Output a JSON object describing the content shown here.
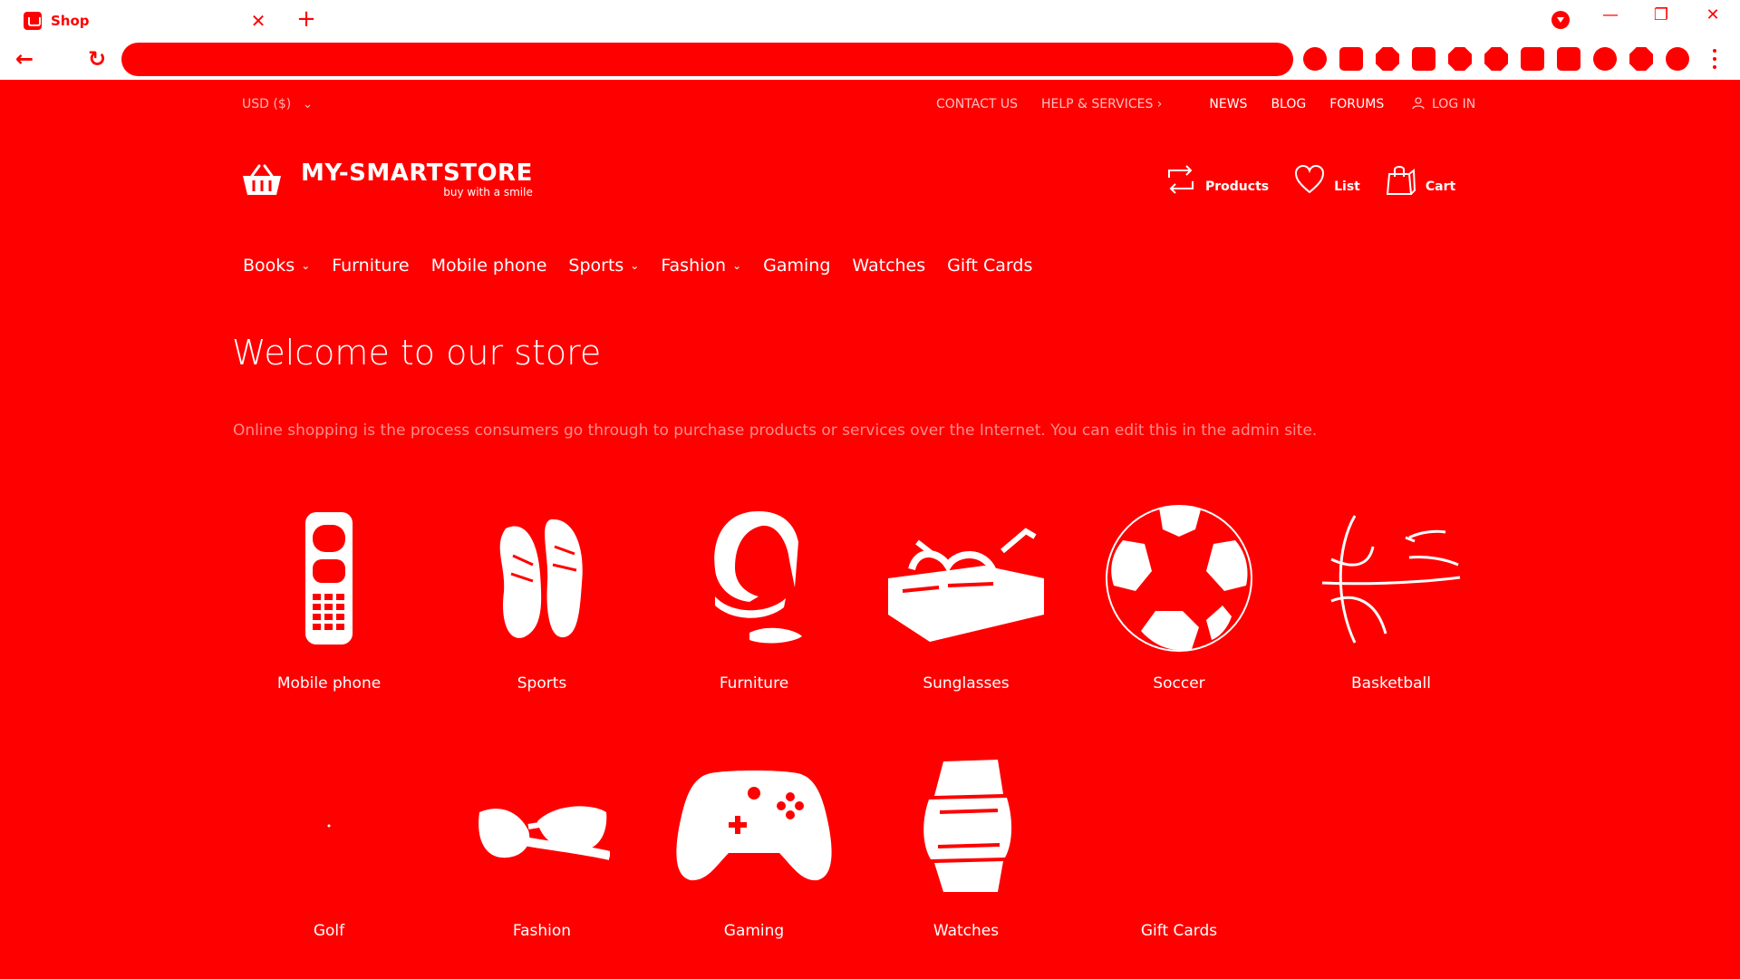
{
  "browser": {
    "tab_title": "Shop",
    "tab_close": "✕",
    "new_tab": "+",
    "nav": {
      "back_icon": "←",
      "reload_icon": "↻"
    },
    "window": {
      "minimize": "—",
      "restore": "❐",
      "close": "✕"
    },
    "accent": "#ff0000"
  },
  "topbar": {
    "currency": "USD ($)",
    "currency_caret": "⌄",
    "links": [
      {
        "label": "CONTACT US"
      },
      {
        "label": "HELP & SERVICES ›"
      },
      {
        "label": "NEWS"
      },
      {
        "label": "BLOG"
      },
      {
        "label": "FORUMS"
      }
    ],
    "login": "LOG IN"
  },
  "logo": {
    "name": "MY-SMARTSTORE",
    "tagline": "buy with a smile"
  },
  "header_actions": [
    {
      "label": "Products",
      "icon": "compare-icon"
    },
    {
      "label": "List",
      "icon": "heart-icon"
    },
    {
      "label": "Cart",
      "icon": "shopping-bag-icon"
    }
  ],
  "nav": [
    {
      "label": "Books",
      "caret": "⌄"
    },
    {
      "label": "Furniture",
      "caret": ""
    },
    {
      "label": "Mobile phone",
      "caret": ""
    },
    {
      "label": "Sports",
      "caret": "⌄"
    },
    {
      "label": "Fashion",
      "caret": "⌄"
    },
    {
      "label": "Gaming",
      "caret": ""
    },
    {
      "label": "Watches",
      "caret": ""
    },
    {
      "label": "Gift Cards",
      "caret": ""
    }
  ],
  "welcome": {
    "title": "Welcome to our store",
    "intro": "Online shopping is the process consumers go through to purchase products or services over the Internet. You can edit this in the admin site."
  },
  "categories": [
    {
      "label": "Mobile phone",
      "icon": "mobile-phone-icon"
    },
    {
      "label": "Sports",
      "icon": "sneakers-icon"
    },
    {
      "label": "Furniture",
      "icon": "chair-icon"
    },
    {
      "label": "Sunglasses",
      "icon": "sunglasses-icon"
    },
    {
      "label": "Soccer",
      "icon": "soccer-ball-icon"
    },
    {
      "label": "Basketball",
      "icon": "basketball-icon"
    },
    {
      "label": "Golf",
      "icon": "golf-icon"
    },
    {
      "label": "Fashion",
      "icon": "sunglasses-fashion-icon"
    },
    {
      "label": "Gaming",
      "icon": "gamepad-icon"
    },
    {
      "label": "Watches",
      "icon": "watch-icon"
    },
    {
      "label": "Gift Cards",
      "icon": "gift-card-icon"
    }
  ]
}
